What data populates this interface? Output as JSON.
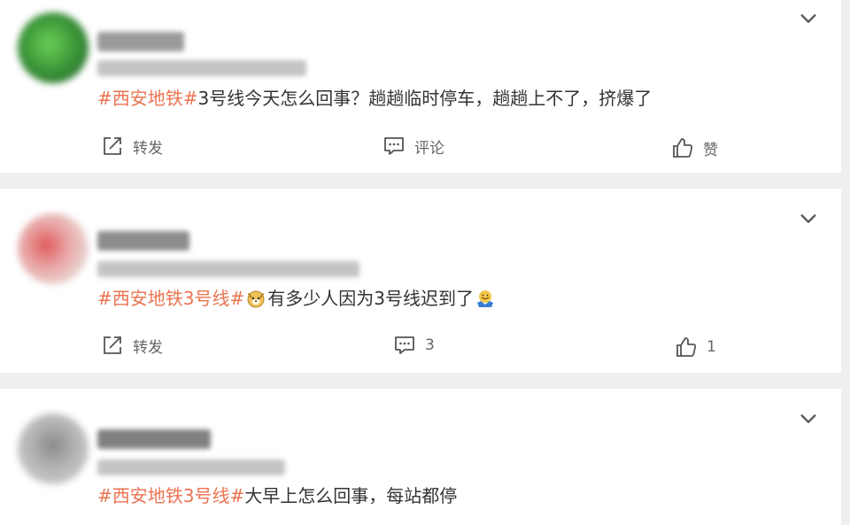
{
  "posts": [
    {
      "tag": "#西安地铁#",
      "text": "3号线今天怎么回事？趟趟临时停车，趟趟上不了，挤爆了",
      "repost_label": "转发",
      "comment_label": "评论",
      "like_label": "赞"
    },
    {
      "tag": "#西安地铁3号线#",
      "text": "有多少人因为3号线迟到了",
      "repost_label": "转发",
      "comment_count": "3",
      "like_count": "1"
    },
    {
      "tag": "#西安地铁3号线#",
      "text": "大早上怎么回事，每站都停"
    }
  ],
  "icons": {
    "repost": "repost-icon",
    "comment": "comment-icon",
    "like": "thumbs-up-icon",
    "expand": "chevron-down-icon"
  },
  "colors": {
    "accent": "#eb7350",
    "text": "#333333",
    "muted": "#666666",
    "background": "#efefef"
  }
}
